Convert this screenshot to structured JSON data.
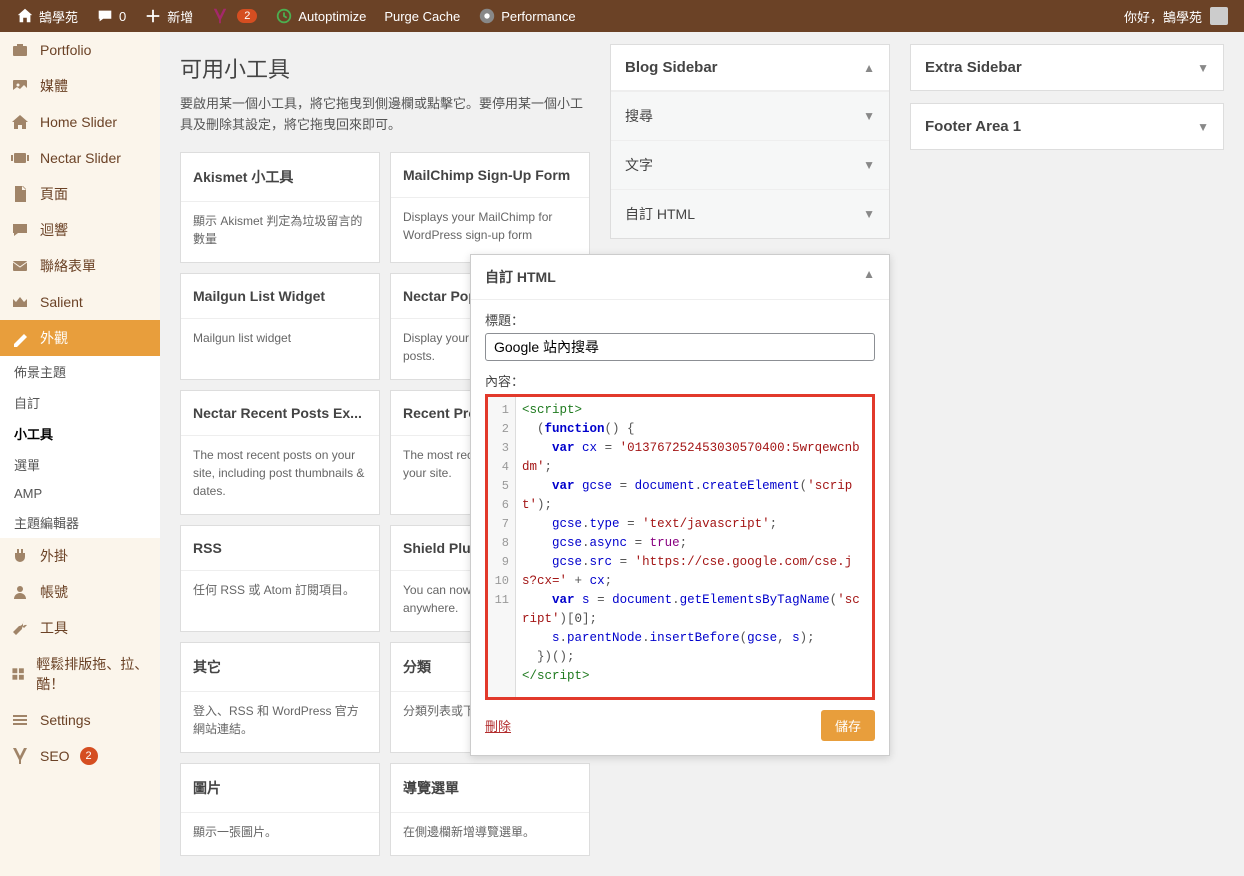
{
  "toolbar": {
    "site_name": "鵠學苑",
    "comments_count": "0",
    "add_new": "新增",
    "yoast_count": "2",
    "autoptimize": "Autoptimize",
    "purge_cache": "Purge Cache",
    "performance": "Performance",
    "greeting": "你好，鵠學苑"
  },
  "sidebar": {
    "items": [
      {
        "label": "Portfolio",
        "icon": "portfolio"
      },
      {
        "label": "媒體",
        "icon": "media"
      },
      {
        "label": "Home Slider",
        "icon": "home"
      },
      {
        "label": "Nectar Slider",
        "icon": "slider"
      },
      {
        "label": "頁面",
        "icon": "pages"
      },
      {
        "label": "迴響",
        "icon": "comments"
      },
      {
        "label": "聯絡表單",
        "icon": "mail"
      },
      {
        "label": "Salient",
        "icon": "crown"
      },
      {
        "label": "外觀",
        "icon": "appearance",
        "active": true
      },
      {
        "label": "外掛",
        "icon": "plugin"
      },
      {
        "label": "帳號",
        "icon": "users"
      },
      {
        "label": "工具",
        "icon": "tools"
      },
      {
        "label": "輕鬆排版拖、拉、酷！",
        "icon": "layout"
      },
      {
        "label": "Settings",
        "icon": "settings"
      },
      {
        "label": "SEO",
        "icon": "seo",
        "badge": "2"
      }
    ],
    "sub": [
      "佈景主題",
      "自訂",
      "小工具",
      "選單",
      "AMP",
      "主題編輯器"
    ],
    "sub_active": "小工具"
  },
  "main": {
    "title": "可用小工具",
    "desc": "要啟用某一個小工具，將它拖曳到側邊欄或點擊它。要停用某一個小工具及刪除其設定，將它拖曳回來即可。",
    "widgets": [
      {
        "name": "Akismet 小工具",
        "desc": "顯示 Akismet 判定為垃圾留言的數量"
      },
      {
        "name": "MailChimp Sign-Up Form",
        "desc": "Displays your MailChimp for WordPress sign-up form"
      },
      {
        "name": "Mailgun List Widget",
        "desc": "Mailgun list widget"
      },
      {
        "name": "Nectar Popular Posts",
        "desc": "Display your most popular posts."
      },
      {
        "name": "Nectar Recent Posts Ex...",
        "desc": "The most recent posts on your site, including post thumbnails & dates."
      },
      {
        "name": "Recent Projects",
        "desc": "The most recent projects on your site."
      },
      {
        "name": "RSS",
        "desc": "任何 RSS 或 Atom 訂閱項目。"
      },
      {
        "name": "Shield Plugin",
        "desc": "You can now place this plugin anywhere."
      },
      {
        "name": "其它",
        "desc": "登入、RSS 和 WordPress 官方網站連結。"
      },
      {
        "name": "分類",
        "desc": "分類列表或下拉選單。"
      },
      {
        "name": "圖片",
        "desc": "顯示一張圖片。"
      },
      {
        "name": "導覽選單",
        "desc": "在側邊欄新增導覽選單。"
      }
    ]
  },
  "areas": {
    "blog_sidebar": {
      "title": "Blog Sidebar",
      "widgets": [
        "搜尋",
        "文字",
        "自訂 HTML"
      ]
    },
    "extra_sidebar": "Extra Sidebar",
    "footer_1": "Footer Area 1"
  },
  "editor": {
    "title": "自訂 HTML",
    "title_label": "標題：",
    "title_value": "Google 站內搜尋",
    "content_label": "內容：",
    "code_lines": [
      "1",
      "2",
      "3",
      "4",
      "5",
      "6",
      "7",
      "8",
      "9",
      "10",
      "11"
    ],
    "delete": "刪除",
    "save": "儲存"
  }
}
